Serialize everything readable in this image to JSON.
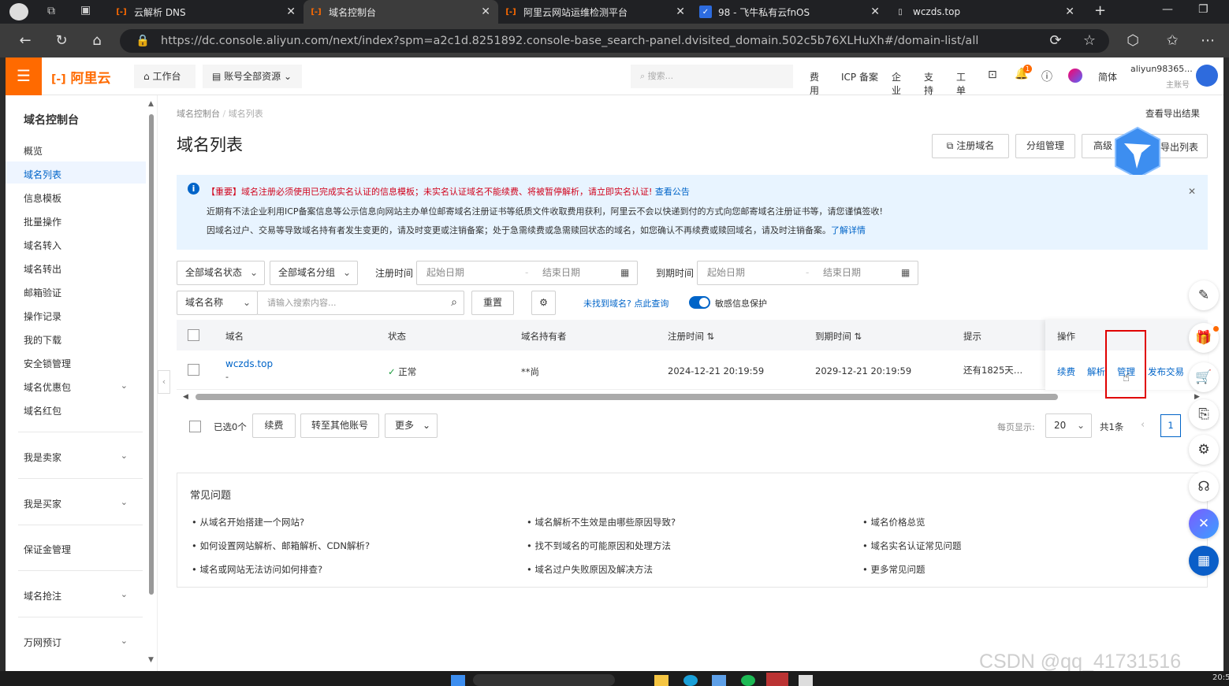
{
  "browser": {
    "tabs": [
      {
        "label": "云解析 DNS",
        "icon": "aliyun-icon"
      },
      {
        "label": "域名控制台",
        "icon": "aliyun-icon",
        "active": true
      },
      {
        "label": "阿里云网站运维检测平台",
        "icon": "aliyun-icon"
      },
      {
        "label": "98 - 飞牛私有云fnOS",
        "icon": "calendar-icon"
      },
      {
        "label": "wczds.top",
        "icon": "page-icon"
      }
    ],
    "url": "https://dc.console.aliyun.com/next/index?spm=a2c1d.8251892.console-base_search-panel.dvisited_domain.502c5b76XLHuXh#/domain-list/all"
  },
  "topnav": {
    "logo": "阿里云",
    "workbench": "工作台",
    "resources": "账号全部资源",
    "search_placeholder": "搜索...",
    "links": [
      "费用",
      "ICP 备案",
      "企业",
      "支持",
      "工单"
    ],
    "notification_count": "1",
    "lang": "简体",
    "account_name": "aliyun98365...",
    "account_role": "主账号"
  },
  "sidebar": {
    "title": "域名控制台",
    "items": [
      "概览",
      "域名列表",
      "信息模板",
      "批量操作",
      "域名转入",
      "域名转出",
      "邮箱验证",
      "操作记录",
      "我的下载",
      "安全锁管理",
      "域名优惠包",
      "域名红包"
    ],
    "groups": [
      "我是卖家",
      "我是买家",
      "保证金管理",
      "域名抢注",
      "万网预订"
    ],
    "active_index": 1
  },
  "main": {
    "breadcrumb": [
      "域名控制台",
      "域名列表"
    ],
    "export_result": "查看导出结果",
    "title": "域名列表",
    "header_buttons": [
      "注册域名",
      "分组管理",
      "高级",
      "导出列表"
    ],
    "notice": {
      "line1_prefix": "【重要】域名注册必须使用已完成实名认证的信息模板；未实名认证域名不能续费、将被暂停解析，请立即实名认证!",
      "line1_link": "查看公告",
      "line2": "近期有不法企业利用ICP备案信息等公示信息向网站主办单位邮寄域名注册证书等纸质文件收取费用获利，阿里云不会以快递到付的方式向您邮寄域名注册证书等，请您谨慎签收!",
      "line3": "因域名过户、交易等导致域名持有者发生变更的，请及时变更或注销备案；处于急需续费或急需赎回状态的域名，如您确认不再续费或赎回域名，请及时注销备案。",
      "line3_link": "了解详情"
    },
    "filters": {
      "status": "全部域名状态",
      "group": "全部域名分组",
      "reg_label": "注册时间",
      "exp_label": "到期时间",
      "start_placeholder": "起始日期",
      "end_placeholder": "结束日期",
      "field": "域名名称",
      "search_placeholder": "请输入搜索内容...",
      "reset": "重置",
      "not_found": "未找到域名? 点此查询",
      "privacy": "敏感信息保护"
    },
    "table": {
      "headers": [
        "域名",
        "状态",
        "域名持有者",
        "注册时间",
        "到期时间",
        "提示",
        "操作"
      ],
      "rows": [
        {
          "domain": "wczds.top",
          "sub": "-",
          "status": "正常",
          "holder": "**尚",
          "reg": "2024-12-21 20:19:59",
          "exp": "2029-12-21 20:19:59",
          "hint": "还有1825天…",
          "actions": [
            "续费",
            "解析",
            "管理",
            "发布交易"
          ]
        }
      ]
    },
    "footer": {
      "selected": "已选0个",
      "buttons": [
        "续费",
        "转至其他账号",
        "更多"
      ],
      "per_page_label": "每页显示:",
      "per_page": "20",
      "total": "共1条",
      "page": "1"
    },
    "faq": {
      "title": "常见问题",
      "items": [
        "从域名开始搭建一个网站?",
        "域名解析不生效是由哪些原因导致?",
        "域名价格总览",
        "如何设置网站解析、邮箱解析、CDN解析?",
        "找不到域名的可能原因和处理方法",
        "域名实名认证常见问题",
        "域名或网站无法访问如何排查?",
        "域名过户失败原因及解决方法",
        "更多常见问题"
      ]
    }
  },
  "watermark": "CSDN @qq_41731516",
  "clock": "20:5",
  "colors": {
    "brand": "#ff6a00",
    "link": "#0064c8",
    "notice_bg": "#e8f4ff",
    "highlight": "#e00000"
  }
}
